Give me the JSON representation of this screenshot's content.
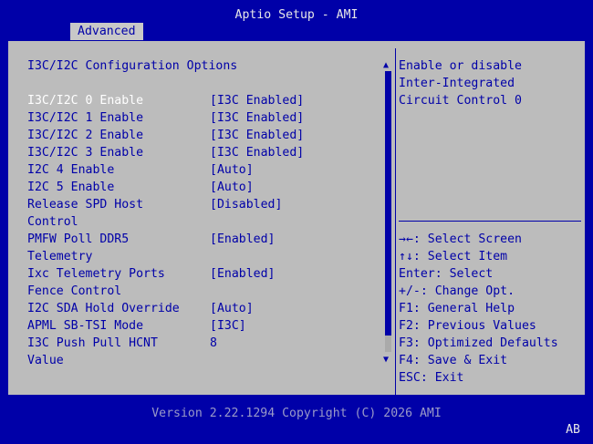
{
  "app_title": "Aptio Setup - AMI",
  "tab": "Advanced",
  "section_title": "I3C/I2C Configuration Options",
  "options": [
    {
      "label": "I3C/I2C 0 Enable",
      "value": "[I3C Enabled]"
    },
    {
      "label": "I3C/I2C 1 Enable",
      "value": "[I3C Enabled]"
    },
    {
      "label": "I3C/I2C 2 Enable",
      "value": "[I3C Enabled]"
    },
    {
      "label": "I3C/I2C 3 Enable",
      "value": "[I3C Enabled]"
    },
    {
      "label": "I2C 4 Enable",
      "value": "[Auto]"
    },
    {
      "label": "I2C 5 Enable",
      "value": "[Auto]"
    },
    {
      "label": "Release SPD Host",
      "value": "[Disabled]"
    },
    {
      "label": "Control",
      "value": ""
    },
    {
      "label": "PMFW Poll DDR5",
      "value": "[Enabled]"
    },
    {
      "label": "Telemetry",
      "value": ""
    },
    {
      "label": "Ixc Telemetry Ports",
      "value": "[Enabled]"
    },
    {
      "label": "Fence Control",
      "value": ""
    },
    {
      "label": "I2C SDA Hold Override",
      "value": "[Auto]"
    },
    {
      "label": "APML SB-TSI Mode",
      "value": "[I3C]"
    },
    {
      "label": "I3C Push Pull HCNT",
      "value": "8"
    },
    {
      "label": "Value",
      "value": ""
    }
  ],
  "help_lines": [
    "Enable or disable",
    "Inter-Integrated",
    "Circuit Control 0"
  ],
  "hotkeys": [
    "→←: Select Screen",
    "↑↓: Select Item",
    "Enter: Select",
    "+/-: Change Opt.",
    "F1: General Help",
    "F2: Previous Values",
    "F3: Optimized Defaults",
    "F4: Save & Exit",
    "ESC: Exit"
  ],
  "footer": "Version 2.22.1294 Copyright (C) 2026 AMI",
  "corner_label": "AB",
  "scroll_up_glyph": "▲",
  "scroll_down_glyph": "▼"
}
